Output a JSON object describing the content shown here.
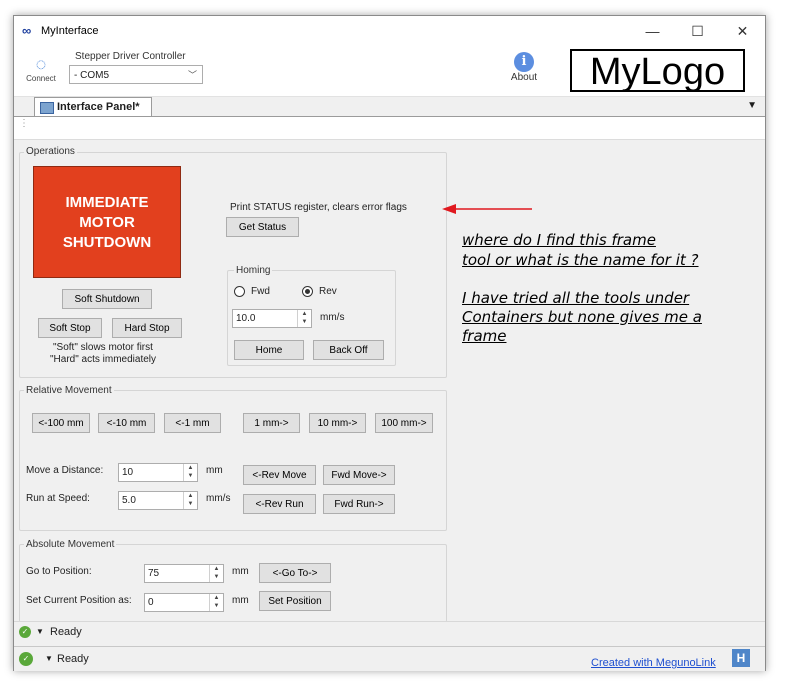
{
  "window": {
    "title": "MyInterface",
    "minimize": "—",
    "maximize": "☐",
    "close": "✕"
  },
  "toolbar": {
    "connect_label": "Connect",
    "controller_label": "Stepper Driver Controller",
    "port_value": "- COM5",
    "about_label": "About",
    "logo_text": "MyLogo"
  },
  "tabs": {
    "active": "Interface Panel*"
  },
  "operations": {
    "title": "Operations",
    "shutdown_lines": [
      "IMMEDIATE",
      "MOTOR",
      "SHUTDOWN"
    ],
    "soft_shutdown": "Soft Shutdown",
    "soft_stop": "Soft Stop",
    "hard_stop": "Hard Stop",
    "note_line1": "\"Soft\" slows motor first",
    "note_line2": "\"Hard\" acts immediately",
    "status_text": "Print STATUS register, clears error flags",
    "get_status": "Get Status"
  },
  "homing": {
    "title": "Homing",
    "fwd": "Fwd",
    "rev": "Rev",
    "selected": "Rev",
    "speed_value": "10.0",
    "speed_unit": "mm/s",
    "home": "Home",
    "back_off": "Back Off"
  },
  "relative": {
    "title": "Relative Movement",
    "buttons": [
      "<-100 mm",
      "<-10 mm",
      "<-1 mm",
      "1 mm->",
      "10 mm->",
      "100 mm->"
    ],
    "distance_label": "Move a Distance:",
    "distance_value": "10",
    "distance_unit": "mm",
    "rev_move": "<-Rev Move",
    "fwd_move": "Fwd Move->",
    "speed_label": "Run at Speed:",
    "speed_value": "5.0",
    "speed_unit": "mm/s",
    "rev_run": "<-Rev Run",
    "fwd_run": "Fwd Run->"
  },
  "absolute": {
    "title": "Absolute Movement",
    "goto_label": "Go to Position:",
    "goto_value": "75",
    "goto_unit": "mm",
    "goto_btn": "<-Go To->",
    "setpos_label": "Set Current Position as:",
    "setpos_value": "0",
    "setpos_unit": "mm",
    "setpos_btn": "Set Position"
  },
  "status": {
    "inner": "Ready",
    "outer": "Ready",
    "link": "Created with MegunoLink",
    "badge": "H"
  },
  "annotation": {
    "line1": "where do I find this frame",
    "line2": "tool or what is the name for it ?",
    "line3": "I have tried all the tools under",
    "line4": "Containers but none gives me a",
    "line5": "frame",
    "arrow_color": "#e0191f"
  }
}
